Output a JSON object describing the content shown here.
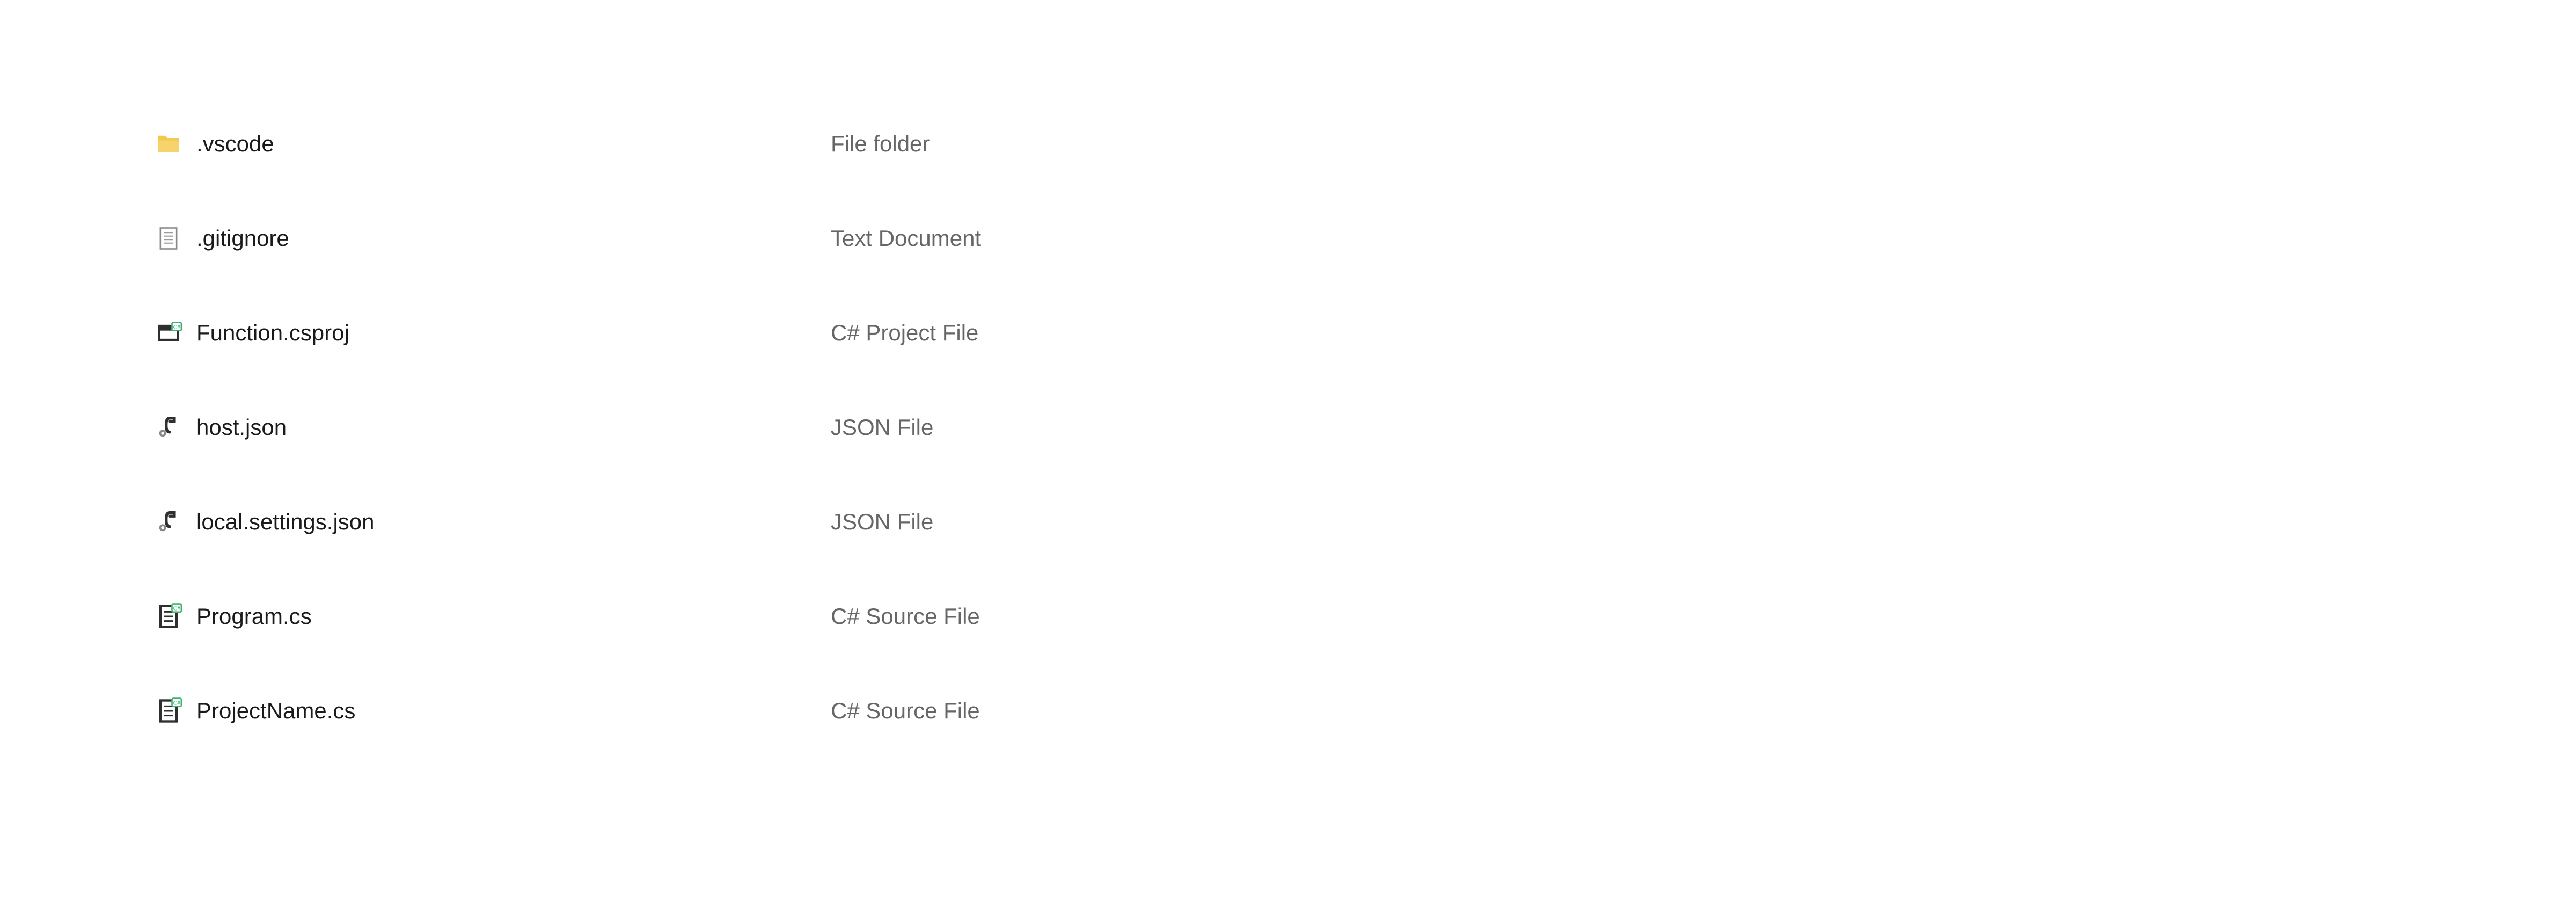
{
  "files": [
    {
      "name": ".vscode",
      "type": "File folder",
      "icon": "folder-icon"
    },
    {
      "name": ".gitignore",
      "type": "Text Document",
      "icon": "text-doc-icon"
    },
    {
      "name": "Function.csproj",
      "type": "C# Project File",
      "icon": "csproj-icon"
    },
    {
      "name": "host.json",
      "type": "JSON File",
      "icon": "json-icon"
    },
    {
      "name": "local.settings.json",
      "type": "JSON File",
      "icon": "json-icon"
    },
    {
      "name": "Program.cs",
      "type": "C# Source File",
      "icon": "cs-source-icon"
    },
    {
      "name": "ProjectName.cs",
      "type": "C# Source File",
      "icon": "cs-source-icon"
    }
  ]
}
